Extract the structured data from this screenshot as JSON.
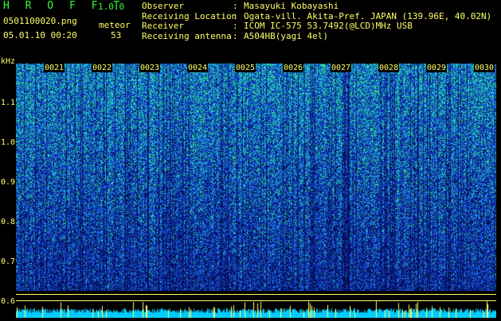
{
  "header": {
    "app_title": "H R O F F T",
    "app_version": "1.0.0",
    "file_name": "0501100020.png",
    "mode": "meteor",
    "datetime": "05.01.10 00:20",
    "count": "53"
  },
  "info": [
    {
      "label": "Observer",
      "sep": ":",
      "value": "Masayuki Kobayashi"
    },
    {
      "label": "Receiving Location",
      "sep": ":",
      "value": "Ogata-vill. Akita-Pref. JAPAN (139.96E, 40.02N)"
    },
    {
      "label": "Receiver",
      "sep": ":",
      "value": "ICOM IC-575 53.7492(@LCD)MHz USB"
    },
    {
      "label": "Receiving antenna",
      "sep": ":",
      "value": "A504HB(yagi 4el)"
    }
  ],
  "axis": {
    "unit": "kHz",
    "y_ticks": [
      "1.1",
      "1.0",
      "0.9",
      "0.8",
      "0.7",
      "0.6"
    ],
    "time_labels": [
      "0021",
      "0022",
      "0023",
      "0024",
      "0025",
      "0026",
      "0027",
      "0028",
      "0029",
      "0030"
    ]
  },
  "colors": {
    "background": "#000000",
    "text": "#ffff66",
    "title": "#33ff33",
    "noise_low": "#0a1a6a",
    "noise_high": "#2a8aff",
    "meteor": "#33ff99",
    "baseline": "#00ccff"
  }
}
